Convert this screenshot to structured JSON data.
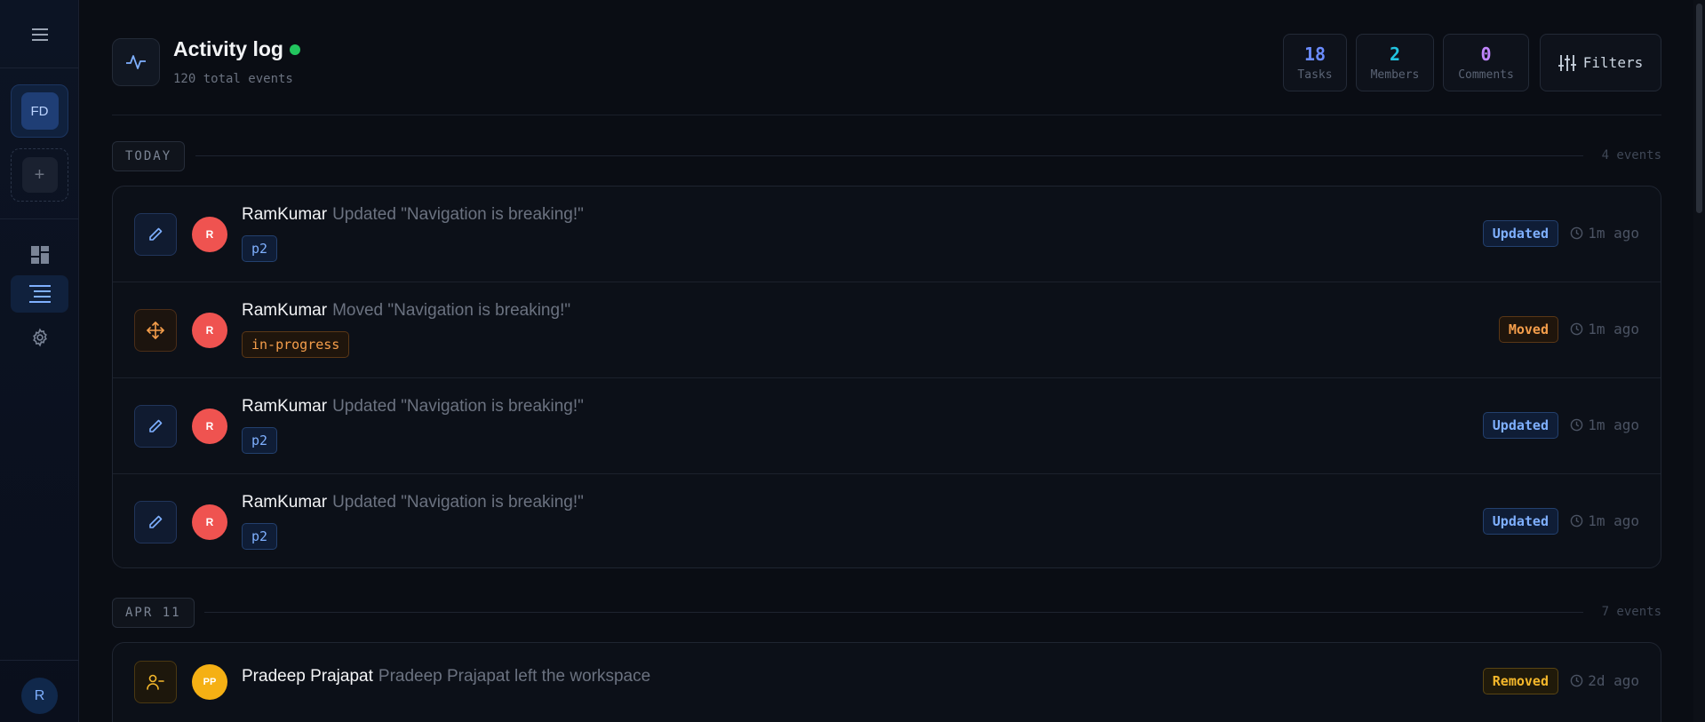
{
  "sidebar": {
    "workspace_initials": "FD",
    "add_symbol": "+",
    "user_initial": "R"
  },
  "header": {
    "title": "Activity log",
    "subtitle": "120 total events",
    "filters_label": "Filters",
    "stats": [
      {
        "value": "18",
        "label": "Tasks",
        "color": "#6b8cff"
      },
      {
        "value": "2",
        "label": "Members",
        "color": "#22c4e0"
      },
      {
        "value": "0",
        "label": "Comments",
        "color": "#c084fc"
      }
    ]
  },
  "groups": [
    {
      "label": "TODAY",
      "count": "4 events",
      "events": [
        {
          "user": "RamKumar",
          "initials": "R",
          "action": "Updated \"Navigation is breaking!\"",
          "tag": "p2",
          "badge": "Updated",
          "time": "1m ago"
        },
        {
          "user": "RamKumar",
          "initials": "R",
          "action": "Moved \"Navigation is breaking!\"",
          "tag": "in-progress",
          "badge": "Moved",
          "time": "1m ago"
        },
        {
          "user": "RamKumar",
          "initials": "R",
          "action": "Updated \"Navigation is breaking!\"",
          "tag": "p2",
          "badge": "Updated",
          "time": "1m ago"
        },
        {
          "user": "RamKumar",
          "initials": "R",
          "action": "Updated \"Navigation is breaking!\"",
          "tag": "p2",
          "badge": "Updated",
          "time": "1m ago"
        }
      ]
    },
    {
      "label": "APR 11",
      "count": "7 events",
      "events": [
        {
          "user": "Pradeep Prajapat",
          "initials": "PP",
          "action": "Pradeep Prajapat left the workspace",
          "badge": "Removed",
          "time": "2d ago"
        }
      ]
    }
  ],
  "colors": {
    "avatar_red": "#ef5350",
    "avatar_amber": "#f5b014",
    "accent_blue": "#7fb0ff",
    "live_green": "#22c55e"
  }
}
